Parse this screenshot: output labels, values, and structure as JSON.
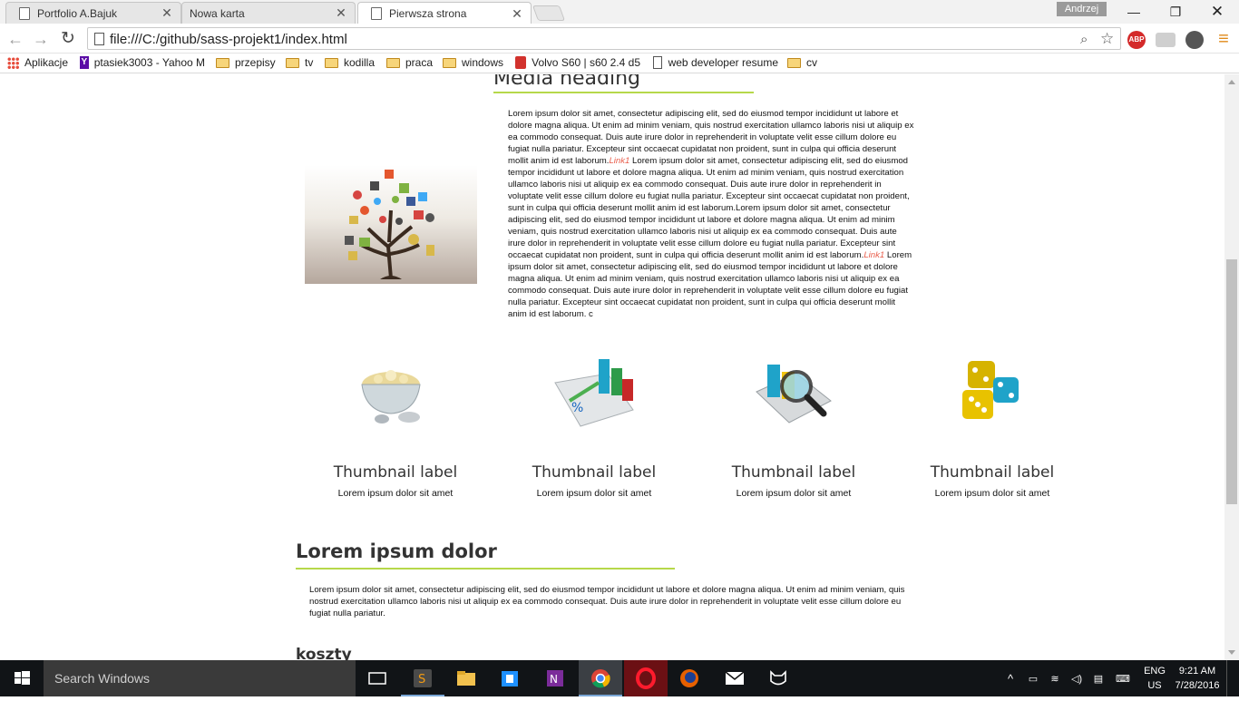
{
  "browser": {
    "tabs": [
      {
        "label": "Portfolio A.Bajuk",
        "active": false
      },
      {
        "label": "Nowa karta",
        "active": false
      },
      {
        "label": "Pierwsza strona",
        "active": true
      }
    ],
    "profile_name": "Andrzej",
    "url": "file:///C:/github/sass-projekt1/index.html",
    "bookmarks": [
      {
        "label": "Aplikacje",
        "icon": "apps-icon"
      },
      {
        "label": "ptasiek3003 - Yahoo M",
        "icon": "yahoo-icon"
      },
      {
        "label": "przepisy",
        "icon": "folder-icon"
      },
      {
        "label": "tv",
        "icon": "folder-icon"
      },
      {
        "label": "kodilla",
        "icon": "folder-icon"
      },
      {
        "label": "praca",
        "icon": "folder-icon"
      },
      {
        "label": "windows",
        "icon": "folder-icon"
      },
      {
        "label": "Volvo S60 | s60 2.4 d5",
        "icon": "volvo-icon"
      },
      {
        "label": "web developer resume",
        "icon": "page-icon"
      },
      {
        "label": "cv",
        "icon": "folder-icon"
      }
    ],
    "extensions": {
      "abp_label": "ABP"
    }
  },
  "page": {
    "media_heading": "Media heading",
    "media_text_1": "Lorem ipsum dolor sit amet, consectetur adipiscing elit, sed do eiusmod tempor incididunt ut labore et dolore magna aliqua. Ut enim ad minim veniam, quis nostrud exercitation ullamco laboris nisi ut aliquip ex ea commodo consequat. Duis aute irure dolor in reprehenderit in voluptate velit esse cillum dolore eu fugiat nulla pariatur. Excepteur sint occaecat cupidatat non proident, sunt in culpa qui officia deserunt mollit anim id est laborum.",
    "link_1": "Link1",
    "media_text_2": " Lorem ipsum dolor sit amet, consectetur adipiscing elit, sed do eiusmod tempor incididunt ut labore et dolore magna aliqua. Ut enim ad minim veniam, quis nostrud exercitation ullamco laboris nisi ut aliquip ex ea commodo consequat. Duis aute irure dolor in reprehenderit in voluptate velit esse cillum dolore eu fugiat nulla pariatur. Excepteur sint occaecat cupidatat non proident, sunt in culpa qui officia deserunt mollit anim id est laborum.Lorem ipsum dolor sit amet, consectetur adipiscing elit, sed do eiusmod tempor incididunt ut labore et dolore magna aliqua. Ut enim ad minim veniam, quis nostrud exercitation ullamco laboris nisi ut aliquip ex ea commodo consequat. Duis aute irure dolor in reprehenderit in voluptate velit esse cillum dolore eu fugiat nulla pariatur. Excepteur sint occaecat cupidatat non proident, sunt in culpa qui officia deserunt mollit anim id est laborum.",
    "link_2": "Link1",
    "media_text_3": " Lorem ipsum dolor sit amet, consectetur adipiscing elit, sed do eiusmod tempor incididunt ut labore et dolore magna aliqua. Ut enim ad minim veniam, quis nostrud exercitation ullamco laboris nisi ut aliquip ex ea commodo consequat. Duis aute irure dolor in reprehenderit in voluptate velit esse cillum dolore eu fugiat nulla pariatur. Excepteur sint occaecat cupidatat non proident, sunt in culpa qui officia deserunt mollit anim id est laborum. c",
    "thumbnails": [
      {
        "label": "Thumbnail label",
        "desc": "Lorem ipsum dolor sit amet",
        "icon": "popcorn-icon"
      },
      {
        "label": "Thumbnail label",
        "desc": "Lorem ipsum dolor sit amet",
        "icon": "chart-icon"
      },
      {
        "label": "Thumbnail label",
        "desc": "Lorem ipsum dolor sit amet",
        "icon": "magnifier-icon"
      },
      {
        "label": "Thumbnail label",
        "desc": "Lorem ipsum dolor sit amet",
        "icon": "dice-icon"
      }
    ],
    "section_heading": "Lorem ipsum dolor",
    "section_text": "Lorem ipsum dolor sit amet, consectetur adipiscing elit, sed do eiusmod tempor incididunt ut labore et dolore magna aliqua. Ut enim ad minim veniam, quis nostrud exercitation ullamco laboris nisi ut aliquip ex ea commodo consequat. Duis aute irure dolor in reprehenderit in voluptate velit esse cillum dolore eu fugiat nulla pariatur.",
    "next_heading": "koszty",
    "accent_color": "#b6d84a",
    "link_color": "#e85c4a"
  },
  "taskbar": {
    "search_placeholder": "Search Windows",
    "language_top": "ENG",
    "language_bottom": "US",
    "time": "9:21 AM",
    "date": "7/28/2016"
  }
}
